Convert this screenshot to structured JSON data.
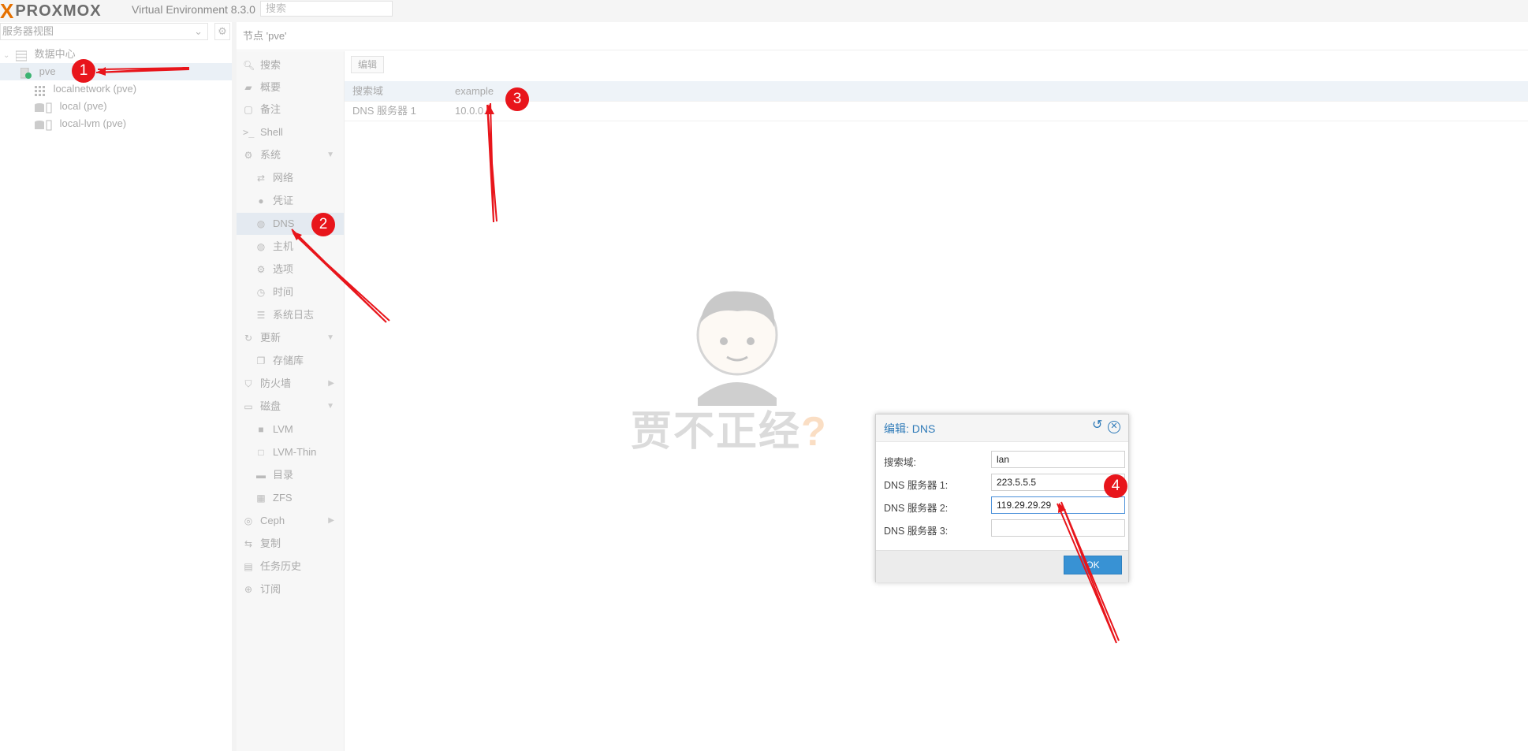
{
  "header": {
    "logo_x": "X",
    "logo_text": "PROXMOX",
    "version": "Virtual Environment 8.3.0",
    "search_placeholder": "搜索"
  },
  "left_panel": {
    "view_label": "服务器视图",
    "tree": [
      {
        "label": "数据中心",
        "icon": "datacenter-icon"
      },
      {
        "label": "pve",
        "icon": "node-online-icon",
        "selected": true
      },
      {
        "label": "localnetwork (pve)",
        "icon": "network-grid-icon"
      },
      {
        "label": "local (pve)",
        "icon": "storage-icon"
      },
      {
        "label": "local-lvm (pve)",
        "icon": "storage-icon"
      }
    ]
  },
  "node_title": "节点 'pve'",
  "nav": [
    {
      "label": "搜索",
      "icon": "search-icon"
    },
    {
      "label": "概要",
      "icon": "book-icon"
    },
    {
      "label": "备注",
      "icon": "note-icon"
    },
    {
      "label": "Shell",
      "icon": "terminal-icon"
    },
    {
      "label": "系统",
      "icon": "cogs-icon"
    },
    {
      "label": "网络",
      "icon": "exchange-icon"
    },
    {
      "label": "凭证",
      "icon": "certificate-icon"
    },
    {
      "label": "DNS",
      "icon": "globe-icon",
      "selected": true
    },
    {
      "label": "主机",
      "icon": "globe-icon"
    },
    {
      "label": "选项",
      "icon": "gear-icon"
    },
    {
      "label": "时间",
      "icon": "clock-icon"
    },
    {
      "label": "系统日志",
      "icon": "list-icon"
    },
    {
      "label": "更新",
      "icon": "refresh-icon"
    },
    {
      "label": "存储库",
      "icon": "files-icon"
    },
    {
      "label": "防火墙",
      "icon": "shield-icon"
    },
    {
      "label": "磁盘",
      "icon": "hdd-icon"
    },
    {
      "label": "LVM",
      "icon": "square-icon"
    },
    {
      "label": "LVM-Thin",
      "icon": "square-outline-icon"
    },
    {
      "label": "目录",
      "icon": "folder-icon"
    },
    {
      "label": "ZFS",
      "icon": "th-large-icon"
    },
    {
      "label": "Ceph",
      "icon": "ceph-icon"
    },
    {
      "label": "复制",
      "icon": "retweet-icon"
    },
    {
      "label": "任务历史",
      "icon": "list-alt-icon"
    },
    {
      "label": "订阅",
      "icon": "support-icon"
    }
  ],
  "toolbar": {
    "edit_label": "编辑"
  },
  "grid": [
    {
      "key": "搜索域",
      "value": "example"
    },
    {
      "key": "DNS 服务器 1",
      "value": "10.0.0."
    }
  ],
  "watermark": {
    "text": "贾不正经",
    "mark": "?"
  },
  "dialog": {
    "title": "编辑: DNS",
    "fields": [
      {
        "label": "搜索域:",
        "value": "lan"
      },
      {
        "label": "DNS 服务器 1:",
        "value": "223.5.5.5"
      },
      {
        "label": "DNS 服务器 2:",
        "value": "119.29.29.29"
      },
      {
        "label": "DNS 服务器 3:",
        "value": ""
      }
    ],
    "ok_label": "OK"
  },
  "annotations": {
    "badges": [
      "1",
      "2",
      "3",
      "4"
    ],
    "color": "#e8151b"
  }
}
